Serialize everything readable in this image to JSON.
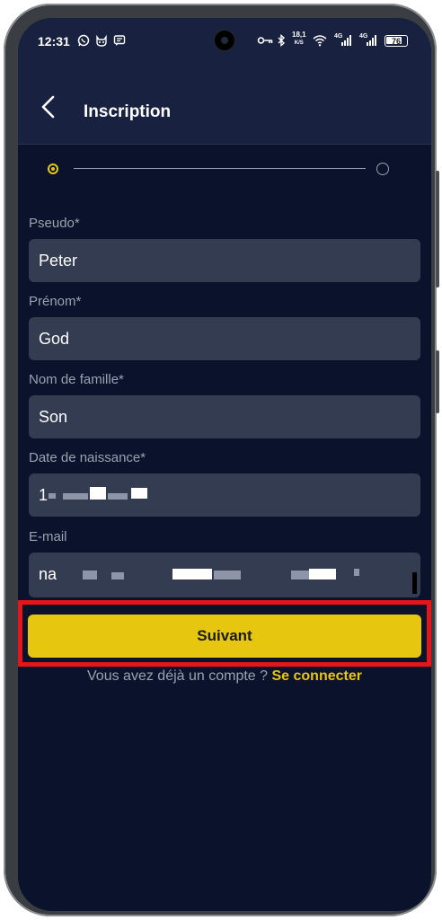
{
  "status_bar": {
    "time": "12:31",
    "net_speed_value": "18,1",
    "net_speed_unit": "K/S",
    "signal1_label": "4G",
    "signal2_label": "4G",
    "battery_level": "76",
    "icons": [
      "whatsapp-icon",
      "cat-icon",
      "message-icon",
      "key-icon",
      "bluetooth-icon",
      "wifi-icon",
      "signal-icon",
      "battery-icon"
    ]
  },
  "header": {
    "title": "Inscription",
    "back_icon": "chevron-left-icon"
  },
  "stepper": {
    "current_step": 1,
    "total_steps": 2,
    "accent_color": "#e8c80f"
  },
  "form": {
    "fields": [
      {
        "label": "Pseudo*",
        "value": "Peter"
      },
      {
        "label": "Prénom*",
        "value": "God"
      },
      {
        "label": "Nom de famille*",
        "value": "Son"
      },
      {
        "label": "Date de naissance*",
        "value": "1"
      },
      {
        "label": "E-mail",
        "value": "na"
      }
    ]
  },
  "actions": {
    "next_label": "Suivant",
    "button_color": "#e6c60f"
  },
  "login": {
    "prompt": "Vous avez déjà un compte ? ",
    "link": "Se connecter"
  },
  "colors": {
    "background": "#0b132c",
    "header_bg": "#182240",
    "field_bg": "#343c52",
    "highlight_border": "#e6141b"
  }
}
